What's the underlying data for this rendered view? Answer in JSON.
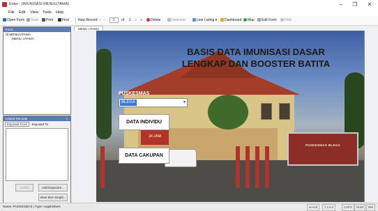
{
  "window": {
    "title": "Enter - [IMUNISASI:MENUUTAMA]",
    "controls": {
      "minimize": "–",
      "maximize": "❐",
      "close": "✕"
    }
  },
  "menu": [
    "File",
    "Edit",
    "View",
    "Tools",
    "Help"
  ],
  "toolbar": {
    "open_form": "Open Form",
    "save": "Save",
    "print": "Print",
    "find": "Find",
    "new_record": "New Record",
    "nav_prev_first": "«",
    "nav_prev": "‹",
    "record_num": "1",
    "of_label": "of",
    "record_total": "1",
    "nav_next": "›",
    "nav_last": "»",
    "delete": "Delete",
    "undelete": "Undelete",
    "line_listing": "Line Listing",
    "dashboard": "Dashboard",
    "map": "Map",
    "edit_form": "Edit Form",
    "help": "Help",
    "colors": {
      "delete": "#d52a2a",
      "open": "#2b6fc2",
      "map": "#2f9e3a",
      "print": "#555555"
    }
  },
  "nav_pane": {
    "header": "Form",
    "tree": [
      {
        "label": "MENUUTAMA",
        "prefix": "⊟"
      },
      {
        "label": "MENU UTAMA",
        "prefix": ""
      }
    ]
  },
  "linked_records": {
    "header": "Linked Records",
    "close": "×",
    "tab_from": "Exposed From",
    "tab_to": "Exposed To",
    "unlink": "Unlink",
    "add_exposure": "Add Exposure...",
    "view_sna": "View SNA Graph..."
  },
  "form": {
    "tab_label": "MENU UTAMA",
    "title_line1": "BASIS DATA IMUNISASI DASAR",
    "title_line2": "LENGKAP DAN BOOSTER BATITA",
    "puskesmas_label": "PUSKESMAS",
    "puskesmas_value": "BLEGA",
    "btn_individu": "DATA INDIVIDU",
    "btn_cakupan": "DATA CAKUPAN",
    "photo_sign": "PUSKESMAS BLEGA",
    "photo_gate": "24 JAM"
  },
  "status": {
    "left": "Name: PUSKESMAS  |  Type: LegalValues",
    "locale": "en-US",
    "version": "7.1.5.2",
    "caps": "CAPS",
    "num": "NUM",
    "ins": "INS"
  }
}
